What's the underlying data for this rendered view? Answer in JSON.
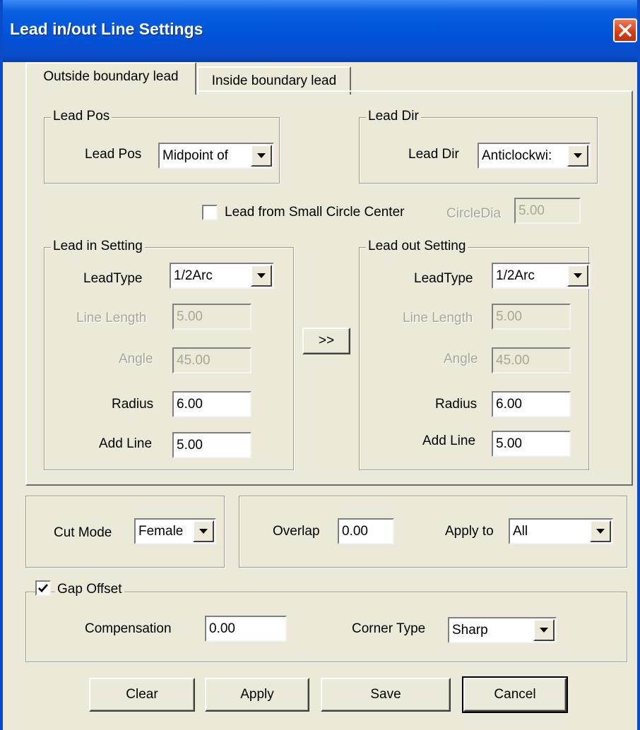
{
  "window": {
    "title": "Lead in/out Line Settings"
  },
  "tabs": [
    {
      "label": "Outside boundary lead"
    },
    {
      "label": "Inside boundary lead"
    }
  ],
  "lead_pos": {
    "group_title": "Lead Pos",
    "label": "Lead Pos",
    "value": "Midpoint of"
  },
  "lead_dir": {
    "group_title": "Lead Dir",
    "label": "Lead Dir",
    "value": "Anticlockwi:"
  },
  "small_circle": {
    "checkbox_label": "Lead from Small Circle Center",
    "checked": false,
    "dia_label": "CircleDia",
    "dia_value": "5.00"
  },
  "lead_in": {
    "group_title": "Lead in Setting",
    "type_label": "LeadType",
    "type_value": "1/2Arc",
    "line_length_label": "Line Length",
    "line_length_value": "5.00",
    "angle_label": "Angle",
    "angle_value": "45.00",
    "radius_label": "Radius",
    "radius_value": "6.00",
    "add_line_label": "Add Line",
    "add_line_value": "5.00"
  },
  "copy_button": {
    "label": ">>"
  },
  "lead_out": {
    "group_title": "Lead out Setting",
    "type_label": "LeadType",
    "type_value": "1/2Arc",
    "line_length_label": "Line Length",
    "line_length_value": "5.00",
    "angle_label": "Angle",
    "angle_value": "45.00",
    "radius_label": "Radius",
    "radius_value": "6.00",
    "add_line_label": "Add Line",
    "add_line_value": "5.00"
  },
  "cut_mode": {
    "label": "Cut Mode",
    "value": "Female"
  },
  "overlap": {
    "label": "Overlap",
    "value": "0.00"
  },
  "apply_to": {
    "label": "Apply to",
    "value": "All"
  },
  "gap_offset": {
    "checkbox_label": "Gap Offset",
    "checked": true,
    "compensation_label": "Compensation",
    "compensation_value": "0.00",
    "corner_type_label": "Corner Type",
    "corner_type_value": "Sharp"
  },
  "buttons": {
    "clear": "Clear",
    "apply": "Apply",
    "save": "Save",
    "cancel": "Cancel"
  }
}
